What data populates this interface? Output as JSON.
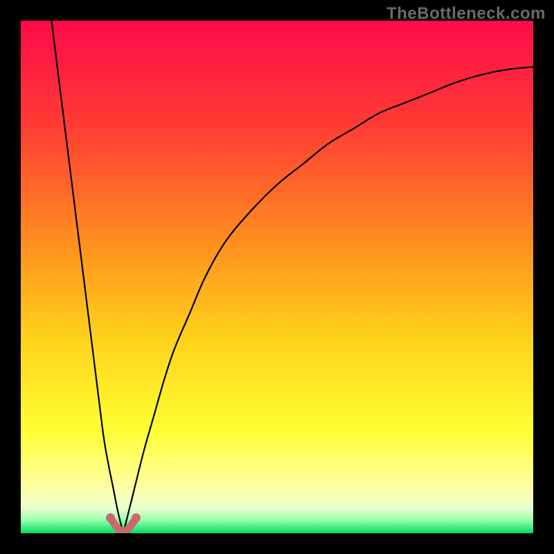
{
  "watermark": "TheBottleneck.com",
  "chart_data": {
    "type": "line",
    "title": "",
    "xlabel": "",
    "ylabel": "",
    "xlim": [
      0,
      100
    ],
    "ylim": [
      0,
      100
    ],
    "note": "No axes, ticks, or legend visible. Values estimated from curve position relative to plot bounds. Two visual segments form one V-shaped curve; minimum touches y≈0 near x≈20. Short red/pink highlight lies at trough over approximately x∈[17.5, 22.5].",
    "series": [
      {
        "name": "left-branch",
        "color": "#000000",
        "x": [
          6,
          8,
          10,
          12,
          14,
          16,
          17,
          18,
          19,
          20
        ],
        "y": [
          100,
          84,
          68,
          52,
          36,
          20,
          14,
          9,
          4,
          0
        ]
      },
      {
        "name": "right-branch",
        "color": "#000000",
        "x": [
          20,
          22,
          24,
          26,
          28,
          30,
          33,
          36,
          40,
          45,
          50,
          55,
          60,
          65,
          70,
          75,
          80,
          85,
          90,
          95,
          100
        ],
        "y": [
          0,
          8,
          16,
          23,
          30,
          36,
          43,
          50,
          57,
          63,
          68,
          72,
          76,
          79,
          82,
          84,
          86,
          88,
          89.5,
          90.5,
          91
        ]
      },
      {
        "name": "trough-highlight",
        "color": "#c96a6a",
        "x": [
          17.5,
          18.5,
          19.5,
          20.5,
          21.5,
          22.5
        ],
        "y": [
          3,
          1.5,
          0.5,
          0.5,
          1.5,
          3
        ]
      }
    ],
    "background_gradient_stops": [
      {
        "offset": 0.0,
        "color": "#ff0a4a"
      },
      {
        "offset": 0.2,
        "color": "#ff3a34"
      },
      {
        "offset": 0.42,
        "color": "#ff8a1f"
      },
      {
        "offset": 0.62,
        "color": "#ffd21a"
      },
      {
        "offset": 0.8,
        "color": "#ffff33"
      },
      {
        "offset": 0.9,
        "color": "#ffff99"
      },
      {
        "offset": 0.95,
        "color": "#ecffd0"
      },
      {
        "offset": 0.973,
        "color": "#9fffb0"
      },
      {
        "offset": 1.0,
        "color": "#00e060"
      }
    ]
  }
}
